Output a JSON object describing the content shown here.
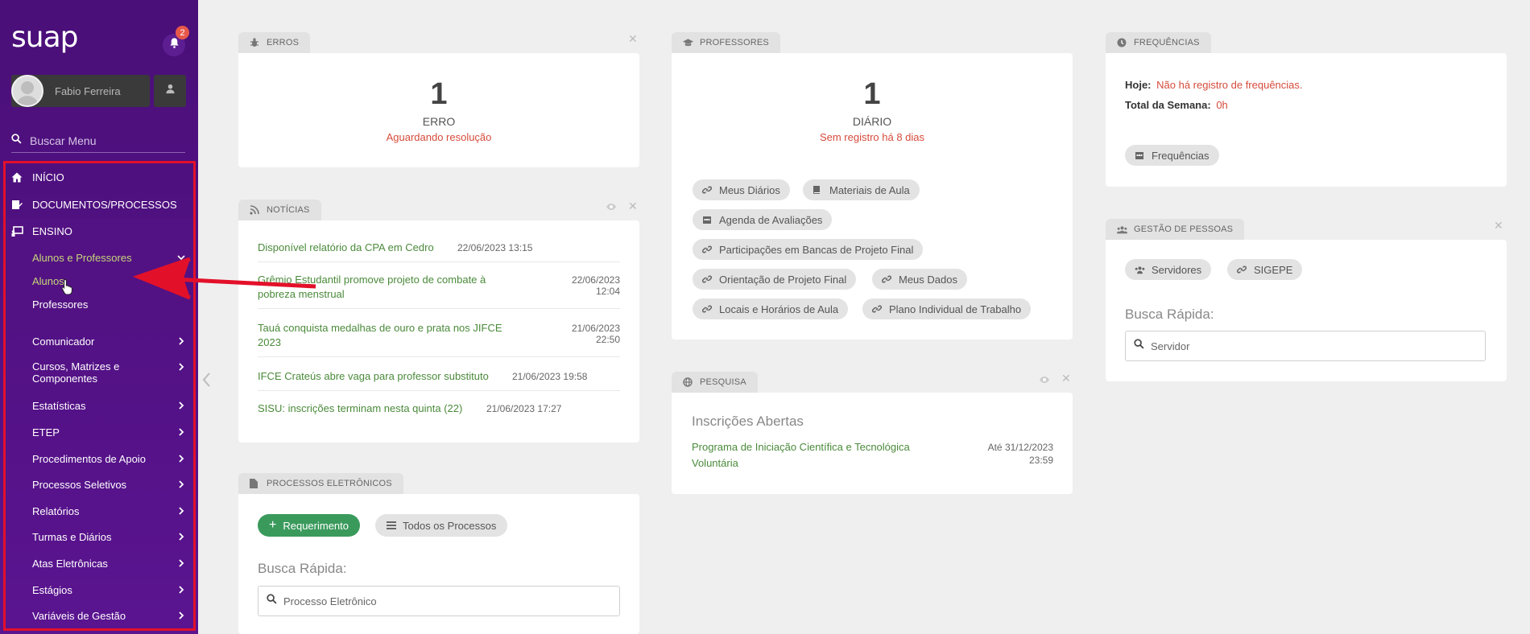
{
  "sidebar": {
    "logo": "suap",
    "notifications_count": "2",
    "user_name": "Fabio Ferreira",
    "search_placeholder": "Buscar Menu",
    "menu": {
      "inicio": "INÍCIO",
      "documentos": "DOCUMENTOS/PROCESSOS",
      "ensino": "ENSINO",
      "alunos_professores": "Alunos e Professores",
      "alunos": "Alunos",
      "professores": "Professores",
      "comunicador": "Comunicador",
      "cursos_l1": "Cursos, Matrizes e",
      "cursos_l2": "Componentes",
      "estatisticas": "Estatísticas",
      "etep": "ETEP",
      "procedimentos": "Procedimentos de Apoio",
      "processos_seletivos": "Processos Seletivos",
      "relatorios": "Relatórios",
      "turmas": "Turmas e Diários",
      "atas": "Atas Eletrônicas",
      "estagios": "Estágios",
      "variaveis": "Variáveis de Gestão"
    }
  },
  "erros": {
    "tab": "ERROS",
    "count": "1",
    "label": "ERRO",
    "sub": "Aguardando resolução"
  },
  "noticias": {
    "tab": "NOTÍCIAS",
    "items": [
      {
        "title": "Disponível relatório da CPA em Cedro",
        "date": "22/06/2023 13:15"
      },
      {
        "title_l1": "Grêmio Estudantil promove projeto de combate à",
        "title_l2": "pobreza menstrual",
        "date_l1": "22/06/2023",
        "date_l2": "12:04"
      },
      {
        "title_l1": "Tauá conquista medalhas de ouro e prata nos JIFCE",
        "title_l2": "2023",
        "date_l1": "21/06/2023",
        "date_l2": "22:50"
      },
      {
        "title": "IFCE Crateús abre vaga para professor substituto",
        "date": "21/06/2023 19:58"
      },
      {
        "title": "SISU: inscrições terminam nesta quinta (22)",
        "date": "21/06/2023 17:27"
      }
    ]
  },
  "processos": {
    "tab": "PROCESSOS ELETRÔNICOS",
    "btn_requerimento": "Requerimento",
    "btn_todos": "Todos os Processos",
    "busca_label": "Busca Rápida:",
    "busca_placeholder": "Processo Eletrônico"
  },
  "professores": {
    "tab": "PROFESSORES",
    "count": "1",
    "label": "DIÁRIO",
    "sub": "Sem registro há 8 dias",
    "links": {
      "meus_diarios": "Meus Diários",
      "materiais": "Materiais de Aula",
      "agenda": "Agenda de Avaliações",
      "participacoes": "Participações em Bancas de Projeto Final",
      "orientacao": "Orientação de Projeto Final",
      "meus_dados": "Meus Dados",
      "locais": "Locais e Horários de Aula",
      "plano": "Plano Individual de Trabalho"
    }
  },
  "pesquisa": {
    "tab": "PESQUISA",
    "heading": "Inscrições Abertas",
    "item_l1": "Programa de Iniciação Científica e Tecnológica",
    "item_l2": "Voluntária",
    "until_l1": "Até 31/12/2023",
    "until_l2": "23:59"
  },
  "frequencias": {
    "tab": "FREQUÊNCIAS",
    "hoje_label": "Hoje:",
    "hoje_value": "Não há registro de frequências.",
    "semana_label": "Total da Semana:",
    "semana_value": "0h",
    "btn": "Frequências"
  },
  "gestao": {
    "tab": "GESTÃO DE PESSOAS",
    "btn_servidores": "Servidores",
    "btn_sigepe": "SIGEPE",
    "busca_label": "Busca Rápida:",
    "busca_placeholder": "Servidor"
  },
  "colors": {
    "sidebar_purple": "#4a0f78",
    "link_green": "#4a8a3a",
    "alert_red": "#d64b3b",
    "annotation_red": "#e3102a",
    "button_green": "#3a9a5c"
  }
}
